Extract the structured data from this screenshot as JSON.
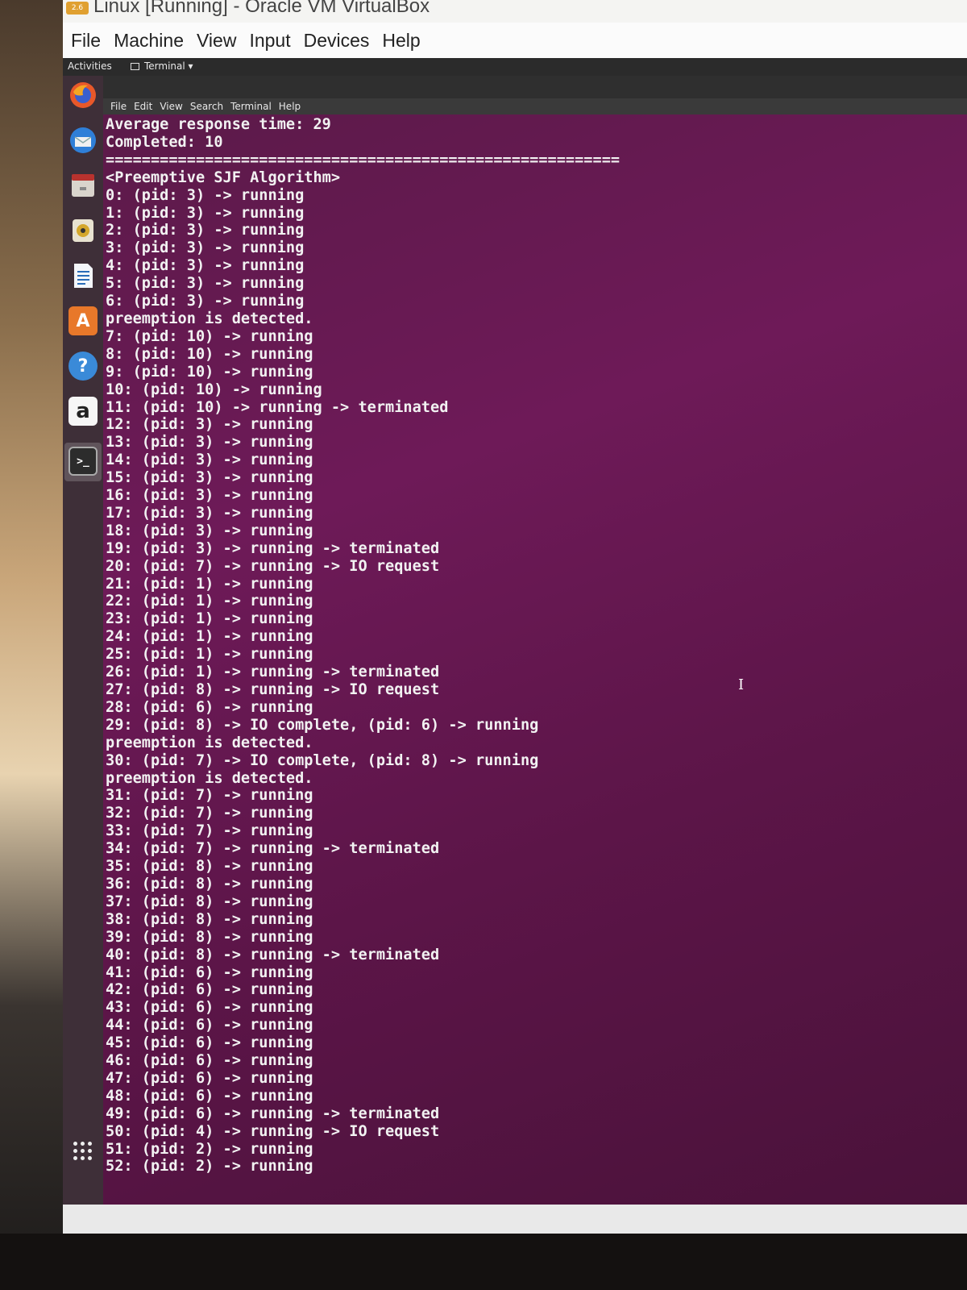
{
  "vbox": {
    "app_icon_label": "2.6",
    "title": "Linux [Running] - Oracle VM VirtualBox",
    "menu": [
      "File",
      "Machine",
      "View",
      "Input",
      "Devices",
      "Help"
    ]
  },
  "gnome": {
    "activities": "Activities",
    "app_menu": "Terminal ▾"
  },
  "dock": {
    "icons": [
      "firefox-icon",
      "thunderbird-icon",
      "files-icon",
      "rhythmbox-icon",
      "writer-icon",
      "software-icon",
      "help-icon",
      "amazon-icon",
      "terminal-icon",
      "show-apps-icon"
    ],
    "amazon_glyph": "a",
    "help_glyph": "?",
    "software_glyph": "A",
    "terminal_glyph": ">_"
  },
  "terminal": {
    "menu": [
      "File",
      "Edit",
      "View",
      "Search",
      "Terminal",
      "Help"
    ],
    "lines": [
      "Average response time: 29",
      "Completed: 10",
      "=========================================================",
      "<Preemptive SJF Algorithm>",
      "0: (pid: 3) -> running",
      "1: (pid: 3) -> running",
      "2: (pid: 3) -> running",
      "3: (pid: 3) -> running",
      "4: (pid: 3) -> running",
      "5: (pid: 3) -> running",
      "6: (pid: 3) -> running",
      "preemption is detected.",
      "7: (pid: 10) -> running",
      "8: (pid: 10) -> running",
      "9: (pid: 10) -> running",
      "10: (pid: 10) -> running",
      "11: (pid: 10) -> running -> terminated",
      "12: (pid: 3) -> running",
      "13: (pid: 3) -> running",
      "14: (pid: 3) -> running",
      "15: (pid: 3) -> running",
      "16: (pid: 3) -> running",
      "17: (pid: 3) -> running",
      "18: (pid: 3) -> running",
      "19: (pid: 3) -> running -> terminated",
      "20: (pid: 7) -> running -> IO request",
      "21: (pid: 1) -> running",
      "22: (pid: 1) -> running",
      "23: (pid: 1) -> running",
      "24: (pid: 1) -> running",
      "25: (pid: 1) -> running",
      "26: (pid: 1) -> running -> terminated",
      "27: (pid: 8) -> running -> IO request",
      "28: (pid: 6) -> running",
      "29: (pid: 8) -> IO complete, (pid: 6) -> running",
      "preemption is detected.",
      "30: (pid: 7) -> IO complete, (pid: 8) -> running",
      "preemption is detected.",
      "31: (pid: 7) -> running",
      "32: (pid: 7) -> running",
      "33: (pid: 7) -> running",
      "34: (pid: 7) -> running -> terminated",
      "35: (pid: 8) -> running",
      "36: (pid: 8) -> running",
      "37: (pid: 8) -> running",
      "38: (pid: 8) -> running",
      "39: (pid: 8) -> running",
      "40: (pid: 8) -> running -> terminated",
      "41: (pid: 6) -> running",
      "42: (pid: 6) -> running",
      "43: (pid: 6) -> running",
      "44: (pid: 6) -> running",
      "45: (pid: 6) -> running",
      "46: (pid: 6) -> running",
      "47: (pid: 6) -> running",
      "48: (pid: 6) -> running",
      "49: (pid: 6) -> running -> terminated",
      "50: (pid: 4) -> running -> IO request",
      "51: (pid: 2) -> running",
      "52: (pid: 2) -> running"
    ],
    "cursor_glyph": "I"
  },
  "colors": {
    "terminal_bg": "#5e1a4c",
    "terminal_fg": "#f2f2f2",
    "dock_bg": "#3e2f38",
    "gnome_bar": "#2b2b2b"
  }
}
